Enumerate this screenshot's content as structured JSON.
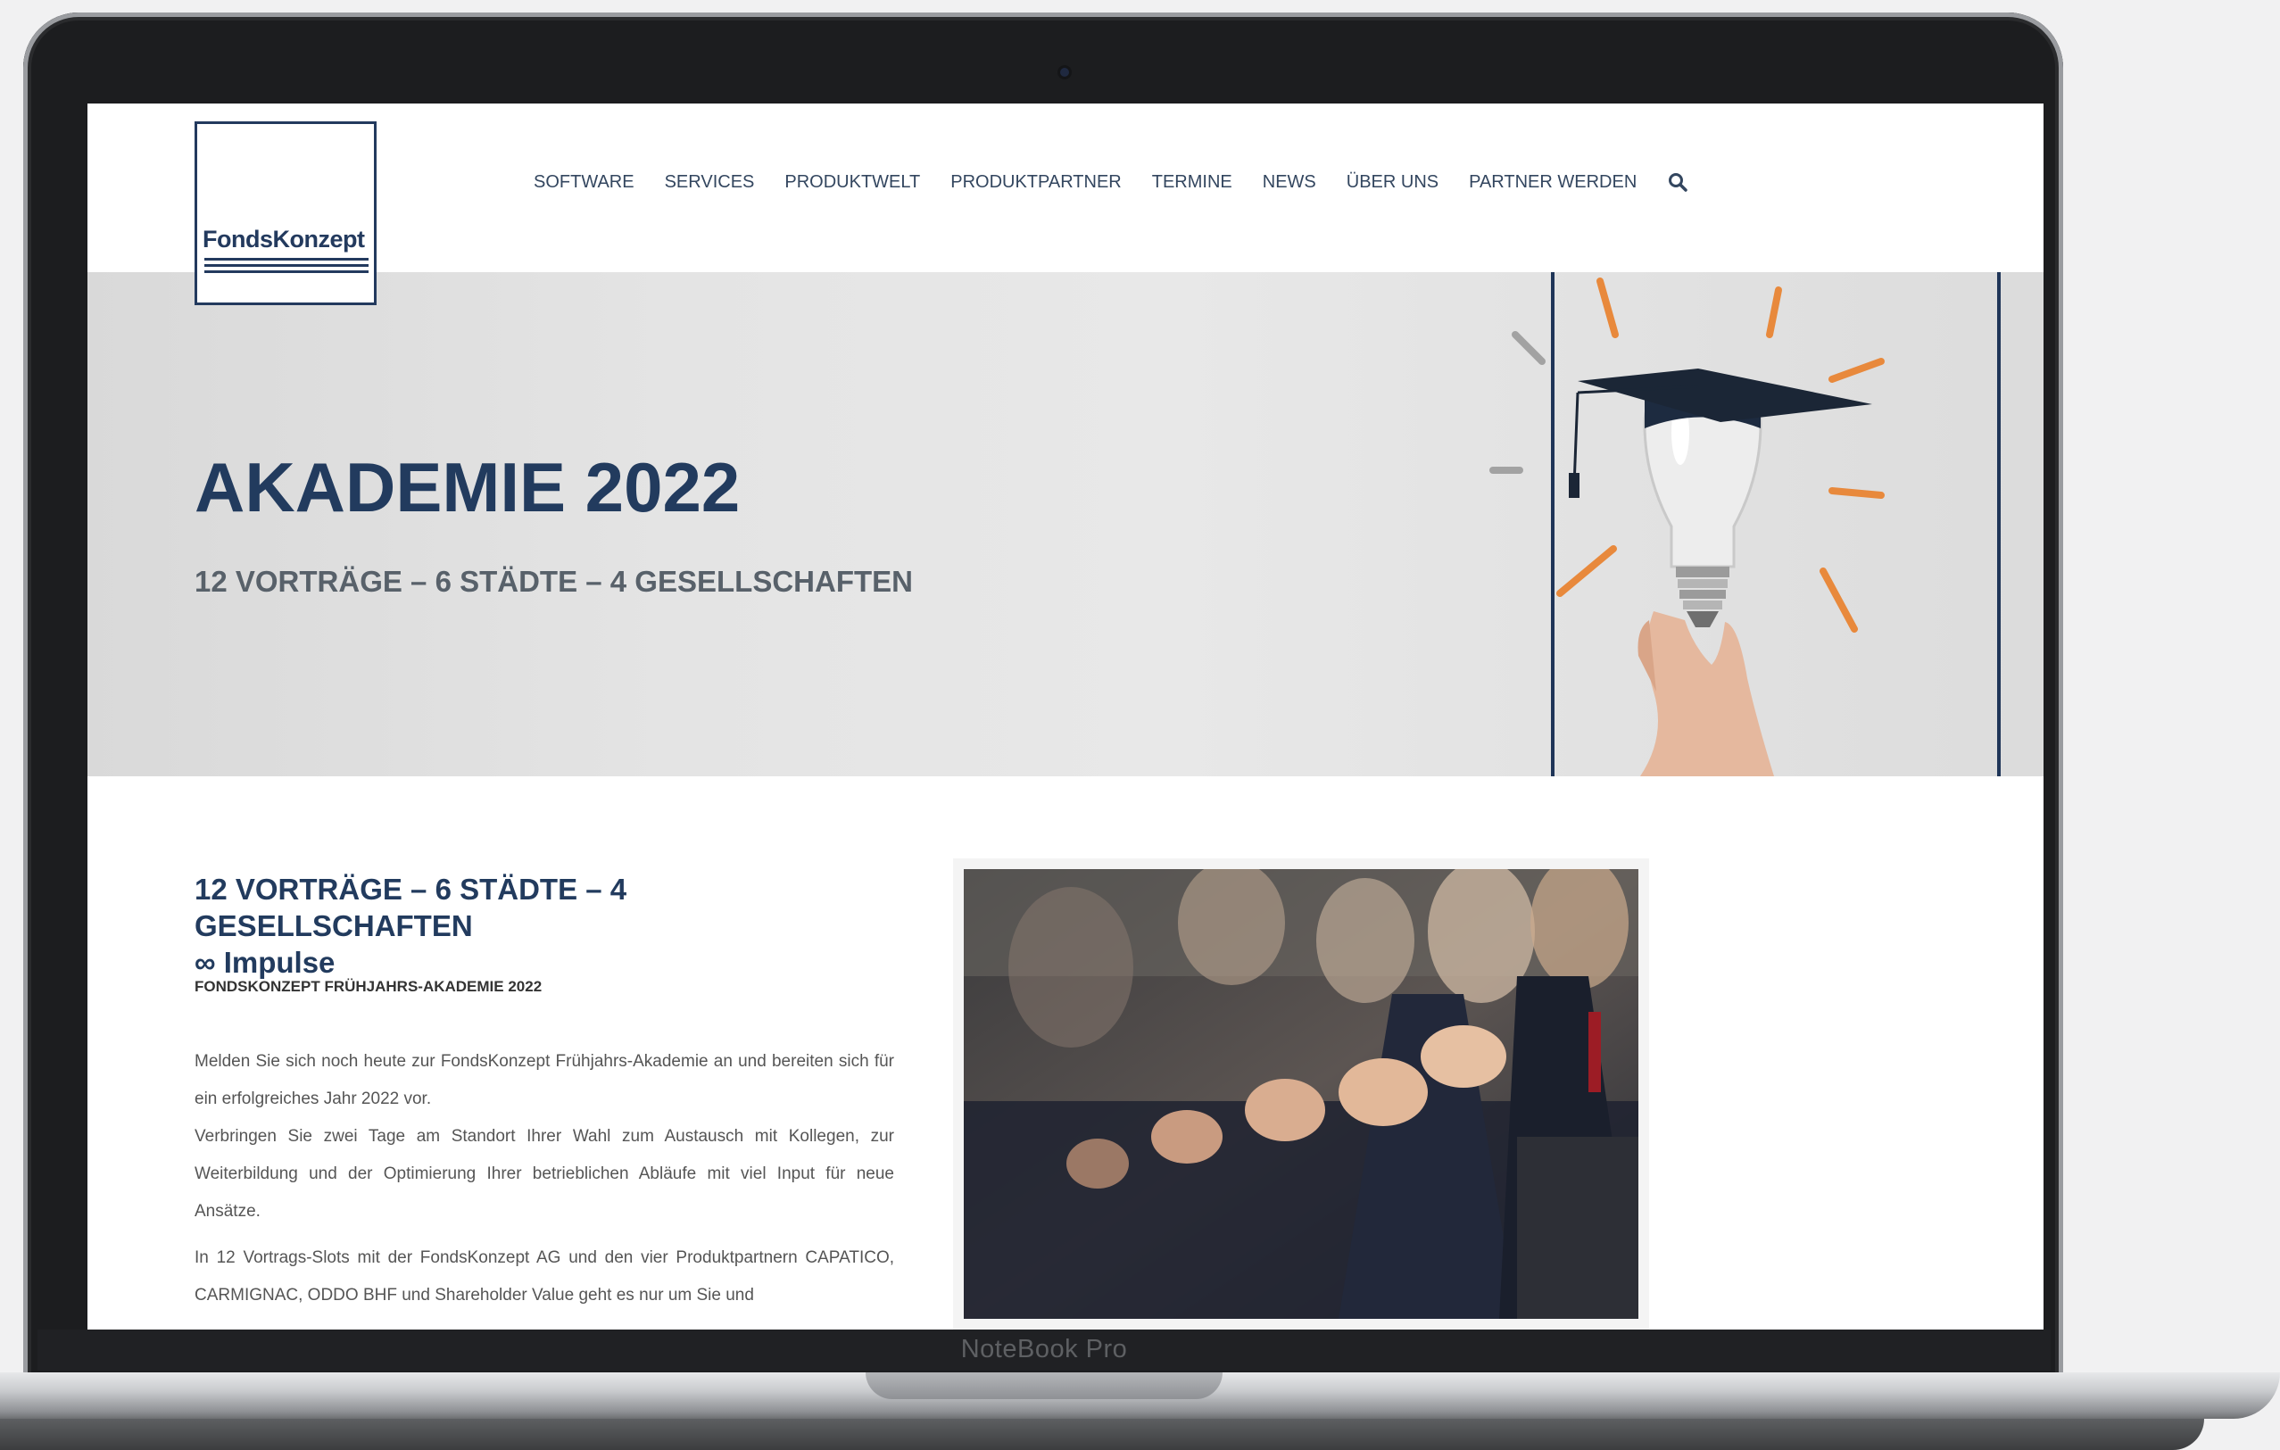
{
  "site": {
    "logo_text": "FondsKonzept",
    "nav": [
      "SOFTWARE",
      "SERVICES",
      "PRODUKTWELT",
      "PRODUKTPARTNER",
      "TERMINE",
      "NEWS",
      "ÜBER UNS",
      "PARTNER WERDEN"
    ]
  },
  "hero": {
    "title": "AKADEMIE 2022",
    "subtitle": "12 VORTRÄGE – 6 STÄDTE – 4 GESELLSCHAFTEN"
  },
  "content": {
    "heading_line1": "12 VORTRÄGE – 6 STÄDTE – 4 GESELLSCHAFTEN",
    "heading_line2": "∞ Impulse",
    "kicker": "FONDSKONZEPT FRÜHJAHRS-AKADEMIE 2022",
    "para1": "Melden Sie sich noch heute zur FondsKonzept Frühjahrs-Akademie an und bereiten sich für ein erfolgreiches Jahr 2022 vor.",
    "para2": "Verbringen Sie zwei Tage am Standort Ihrer Wahl zum Austausch mit Kollegen, zur Weiterbildung und der Optimierung Ihrer betrieblichen Abläufe mit viel Input für neue Ansätze.",
    "para3": "In 12 Vortrags-Slots mit der FondsKonzept AG und den vier Produktpartnern CAPATICO, CARMIGNAC, ODDO BHF und Shareholder Value geht es nur um Sie und"
  },
  "device": {
    "label": "NoteBook Pro"
  },
  "colors": {
    "brand_navy": "#223b5e",
    "accent_orange": "#e8893c",
    "hero_gray": "#e2e2e2"
  },
  "icons": [
    "search-icon",
    "camera-icon"
  ]
}
